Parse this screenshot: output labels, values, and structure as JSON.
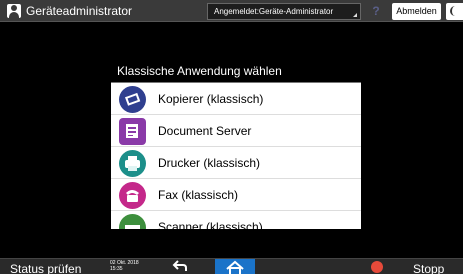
{
  "header": {
    "title": "Geräteadministrator",
    "logged_in": "Angemeldet:Geräte-Administrator",
    "help_label": "?",
    "logout_label": "Abmelden"
  },
  "dialog": {
    "title": "Klassische Anwendung wählen",
    "items": [
      {
        "label": "Kopierer (klassisch)",
        "icon": "copier-icon",
        "color": "#2f3f8f"
      },
      {
        "label": "Document Server",
        "icon": "document-server-icon",
        "color": "#8a3aa8"
      },
      {
        "label": "Drucker (klassisch)",
        "icon": "printer-icon",
        "color": "#1c8f8a"
      },
      {
        "label": "Fax (klassisch)",
        "icon": "fax-icon",
        "color": "#c4288a"
      },
      {
        "label": "Scanner (klassisch)",
        "icon": "scanner-icon",
        "color": "#3d8f3d"
      }
    ]
  },
  "footer": {
    "status_label": "Status prüfen",
    "date": "02 Okt. 2018",
    "time": "15:35",
    "stop_label": "Stopp",
    "home_color": "#1a73c9",
    "stop_color": "#e64a3a"
  }
}
